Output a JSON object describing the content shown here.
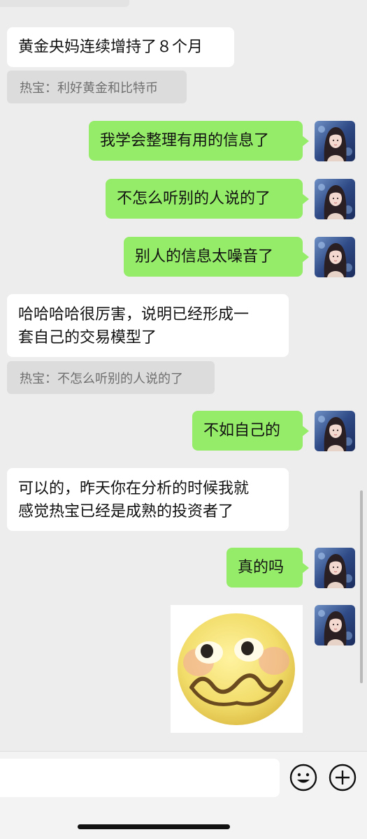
{
  "messages": [
    {
      "side": "left",
      "text": "黄金央妈连续增持了８个月"
    },
    {
      "side": "quote",
      "text": "热宝：利好黄金和比特币"
    },
    {
      "side": "right",
      "text": "我学会整理有用的信息了"
    },
    {
      "side": "right",
      "text": "不怎么听别的人说的了"
    },
    {
      "side": "right",
      "text": "别人的信息太噪音了"
    },
    {
      "side": "left",
      "line1": "哈哈哈哈很厉害，说明已经形成一",
      "line2": "套自己的交易模型了"
    },
    {
      "side": "quote",
      "text": "热宝：不怎么听别的人说的了"
    },
    {
      "side": "right",
      "text": "不如自己的"
    },
    {
      "side": "left",
      "line1": "可以的，昨天你在分析的时候我就",
      "line2": "感觉热宝已经是成熟的投资者了"
    },
    {
      "side": "right",
      "text": "真的吗"
    },
    {
      "side": "right",
      "type": "sticker",
      "icon": "blushing-emoji-sticker"
    }
  ],
  "input": {
    "value": "",
    "placeholder": ""
  },
  "icons": {
    "emoji": "smiley-icon",
    "more": "plus-icon",
    "avatar": "user-avatar"
  },
  "colors": {
    "background": "#ededed",
    "right_bubble": "#95ec69",
    "left_bubble": "#ffffff",
    "quote": "#dcdcdc"
  }
}
